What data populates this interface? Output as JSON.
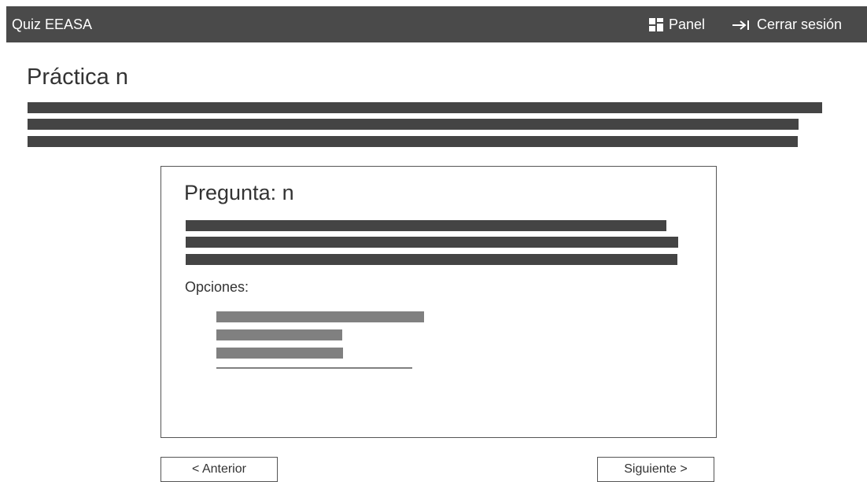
{
  "header": {
    "app_title": "Quiz EEASA",
    "panel_label": "Panel",
    "panel_icon": "dashboard-icon",
    "logout_label": "Cerrar sesión",
    "logout_icon": "logout-icon"
  },
  "page": {
    "title": "Práctica n"
  },
  "question": {
    "title": "Pregunta: n",
    "options_label": "Opciones:"
  },
  "navigation": {
    "previous_label": "< Anterior",
    "next_label": "Siguiente >"
  },
  "colors": {
    "topbar": "#4a4a4a",
    "text_bars": "#444444",
    "option_bars": "#808080"
  }
}
